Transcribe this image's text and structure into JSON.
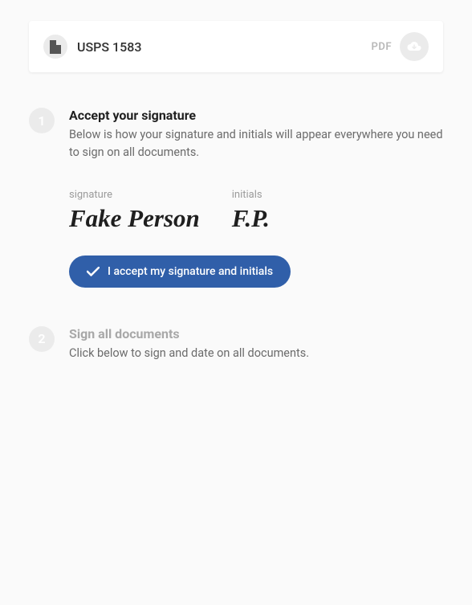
{
  "document": {
    "title": "USPS 1583",
    "format": "PDF"
  },
  "steps": [
    {
      "number": "1",
      "title": "Accept your signature",
      "description": "Below is how your signature and initials will appear everywhere you need to sign on all documents.",
      "active": true
    },
    {
      "number": "2",
      "title": "Sign all documents",
      "description": "Click below to sign and date on all documents.",
      "active": false
    }
  ],
  "signature": {
    "sig_label": "signature",
    "sig_value": "Fake Person",
    "initials_label": "initials",
    "initials_value": "F.P."
  },
  "buttons": {
    "accept": "I accept my signature and initials"
  }
}
